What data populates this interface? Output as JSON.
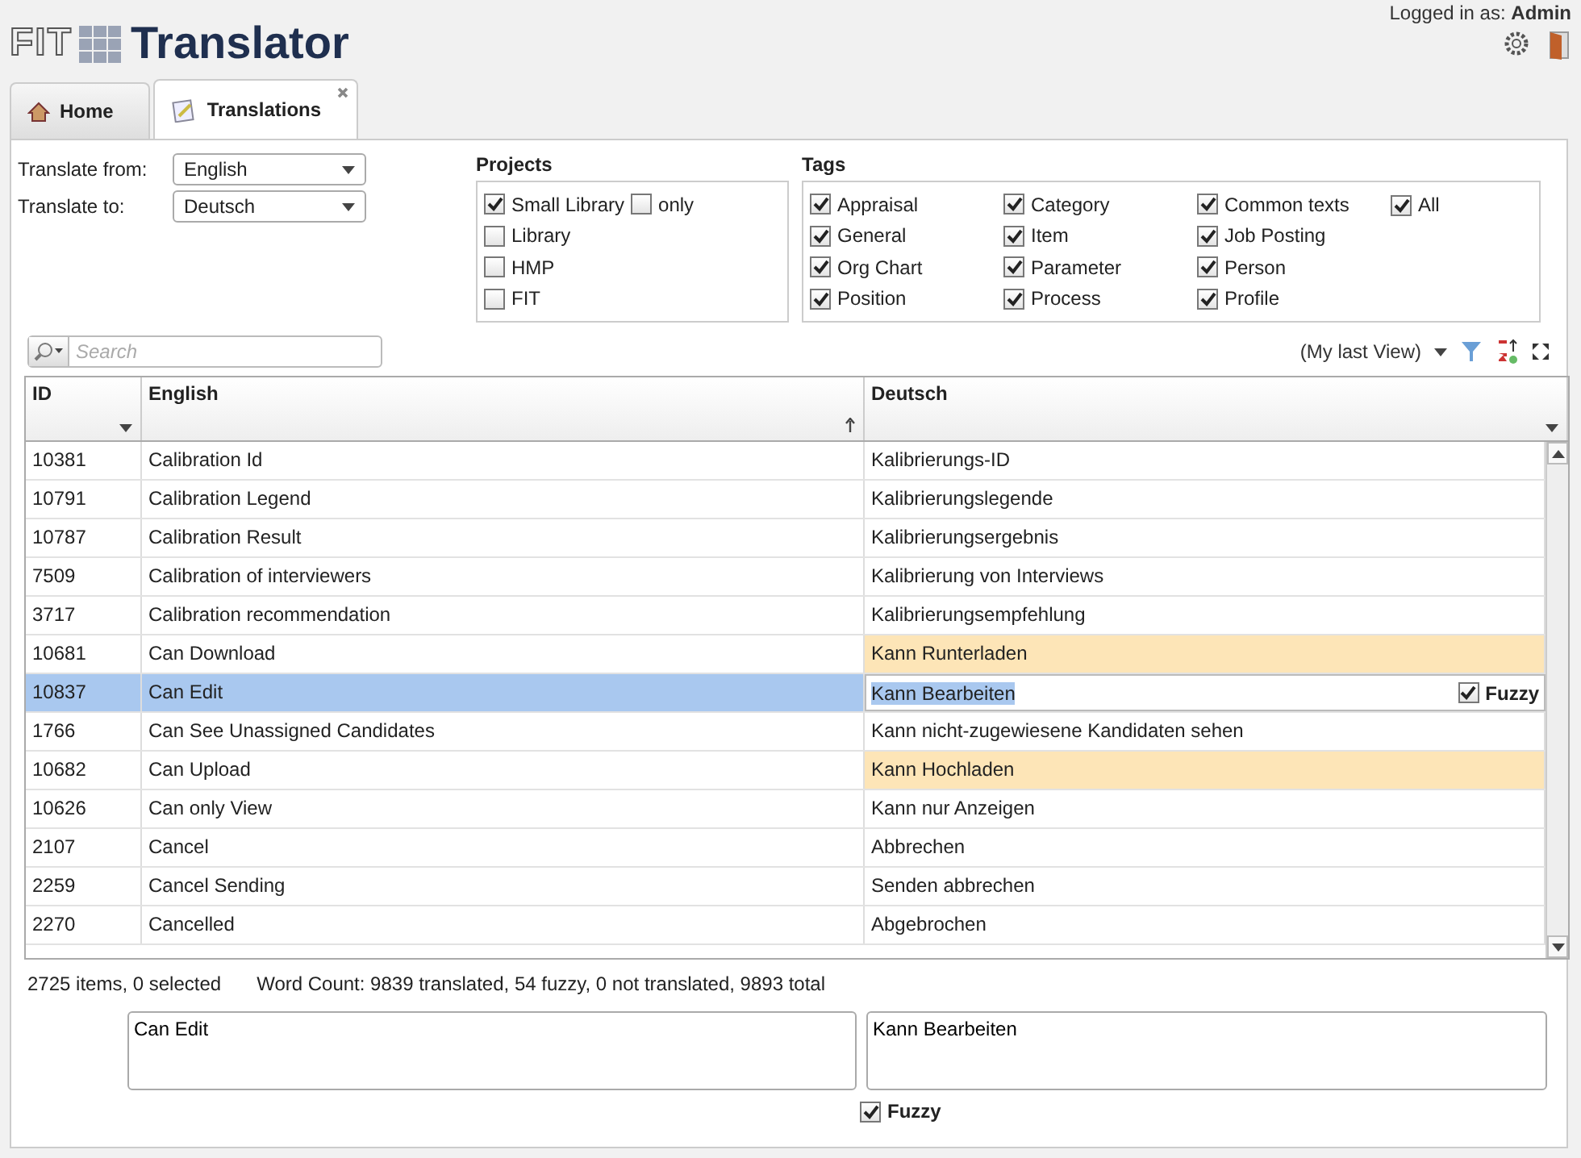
{
  "header": {
    "logo_prefix": "FIT",
    "logo_name": "Translator",
    "login_label": "Logged in as:",
    "user": "Admin"
  },
  "tabs": [
    {
      "label": "Home",
      "selected": false,
      "closable": false
    },
    {
      "label": "Translations",
      "selected": true,
      "closable": true
    }
  ],
  "languages": [
    {
      "label": "Translate from:",
      "value": "English"
    },
    {
      "label": "Translate to:",
      "value": "Deutsch"
    }
  ],
  "projects": {
    "title": "Projects",
    "items": [
      {
        "label": "Small Library",
        "checked": true,
        "only": {
          "label": "only",
          "checked": false
        }
      },
      {
        "label": "Library",
        "checked": false
      },
      {
        "label": "HMP",
        "checked": false
      },
      {
        "label": "FIT",
        "checked": false
      }
    ]
  },
  "tags": {
    "title": "Tags",
    "columns": [
      [
        {
          "label": "Appraisal",
          "checked": true
        },
        {
          "label": "General",
          "checked": true
        },
        {
          "label": "Org Chart",
          "checked": true
        },
        {
          "label": "Position",
          "checked": true
        }
      ],
      [
        {
          "label": "Category",
          "checked": true
        },
        {
          "label": "Item",
          "checked": true
        },
        {
          "label": "Parameter",
          "checked": true
        },
        {
          "label": "Process",
          "checked": true
        }
      ],
      [
        {
          "label": "Common texts",
          "checked": true
        },
        {
          "label": "Job Posting",
          "checked": true
        },
        {
          "label": "Person",
          "checked": true
        },
        {
          "label": "Profile",
          "checked": true
        }
      ],
      [
        {
          "label": "All",
          "checked": true
        }
      ]
    ]
  },
  "toolbar": {
    "search_placeholder": "Search",
    "view": "(My last View)"
  },
  "table": {
    "columns": [
      {
        "label": "ID",
        "sorted": false
      },
      {
        "label": "English",
        "sorted": true
      },
      {
        "label": "Deutsch",
        "sorted": false
      }
    ],
    "fuzzy_label": "Fuzzy",
    "rows": [
      {
        "id": "10381",
        "english": "Calibration Id",
        "deutsch": "Kalibrierungs-ID",
        "fuzzy": false,
        "selected": false
      },
      {
        "id": "10791",
        "english": "Calibration Legend",
        "deutsch": "Kalibrierungslegende",
        "fuzzy": false,
        "selected": false
      },
      {
        "id": "10787",
        "english": "Calibration Result",
        "deutsch": "Kalibrierungsergebnis",
        "fuzzy": false,
        "selected": false
      },
      {
        "id": "7509",
        "english": "Calibration of interviewers",
        "deutsch": "Kalibrierung von Interviews",
        "fuzzy": false,
        "selected": false
      },
      {
        "id": "3717",
        "english": "Calibration recommendation",
        "deutsch": "Kalibrierungsempfehlung",
        "fuzzy": false,
        "selected": false
      },
      {
        "id": "10681",
        "english": "Can Download",
        "deutsch": "Kann Runterladen",
        "fuzzy": true,
        "selected": false
      },
      {
        "id": "10837",
        "english": "Can Edit",
        "deutsch": "Kann Bearbeiten",
        "fuzzy": true,
        "selected": true
      },
      {
        "id": "1766",
        "english": "Can See Unassigned Candidates",
        "deutsch": "Kann nicht-zugewiesene Kandidaten sehen",
        "fuzzy": false,
        "selected": false
      },
      {
        "id": "10682",
        "english": "Can Upload",
        "deutsch": "Kann Hochladen",
        "fuzzy": true,
        "selected": false
      },
      {
        "id": "10626",
        "english": "Can only View",
        "deutsch": "Kann nur Anzeigen",
        "fuzzy": false,
        "selected": false
      },
      {
        "id": "2107",
        "english": "Cancel",
        "deutsch": "Abbrechen",
        "fuzzy": false,
        "selected": false
      },
      {
        "id": "2259",
        "english": "Cancel Sending",
        "deutsch": "Senden abbrechen",
        "fuzzy": false,
        "selected": false
      },
      {
        "id": "2270",
        "english": "Cancelled",
        "deutsch": "Abgebrochen",
        "fuzzy": false,
        "selected": false
      }
    ]
  },
  "status": {
    "items": "2725 items, 0 selected",
    "word_count": "Word Count: 9839 translated, 54 fuzzy, 0 not translated, 9893 total"
  },
  "editor": {
    "source": "Can Edit",
    "target": "Kann Bearbeiten",
    "fuzzy": {
      "label": "Fuzzy",
      "checked": true
    }
  }
}
